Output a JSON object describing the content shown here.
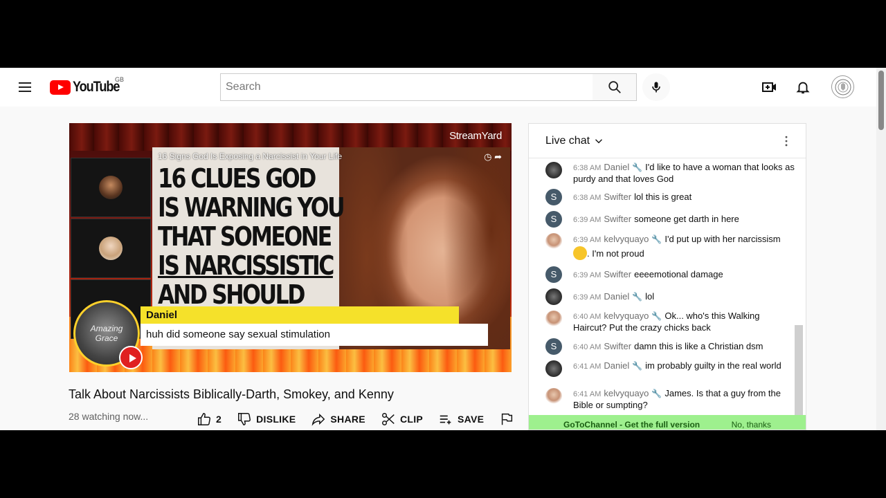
{
  "masthead": {
    "logo_text": "YouTube",
    "country_code": "GB",
    "search_placeholder": "Search"
  },
  "video": {
    "streamyard_label": "StreamYard",
    "thumbnail_caption": "16 Signs God Is Exposing a Narcissist in Your Life",
    "headline_lines": [
      "16 CLUES GOD",
      "IS WARNING YOU",
      "THAT SOMEONE",
      "IS NARCISSISTIC",
      "AND SHOULD"
    ],
    "badge_text": "Amazing Grace",
    "lower_third_name": "Daniel",
    "lower_third_message": "huh did someone say sexual stimulation",
    "title": "Talk About Narcissists Biblically-Darth, Smokey, and Kenny",
    "watching": "28 watching now...",
    "actions": {
      "like_count": "2",
      "dislike": "DISLIKE",
      "share": "SHARE",
      "clip": "CLIP",
      "save": "SAVE"
    }
  },
  "chat": {
    "title": "Live chat",
    "messages": [
      {
        "time": "6:38 AM",
        "author": "Daniel",
        "text": "I'd like to have a woman that looks as purdy and that loves God"
      },
      {
        "time": "6:38 AM",
        "author": "Swifter",
        "text": "lol this is great"
      },
      {
        "time": "6:39 AM",
        "author": "Swifter",
        "text": "someone get darth in here"
      },
      {
        "time": "6:39 AM",
        "author": "kelvyquayo",
        "text": "I'd put up with her narcissism",
        "text_after": ". I'm not proud"
      },
      {
        "time": "6:39 AM",
        "author": "Swifter",
        "text": "eeeemotional damage"
      },
      {
        "time": "6:39 AM",
        "author": "Daniel",
        "text": "lol"
      },
      {
        "time": "6:40 AM",
        "author": "kelvyquayo",
        "text": "Ok... who's this Walking Haircut? Put the crazy chicks back"
      },
      {
        "time": "6:40 AM",
        "author": "Swifter",
        "text": "damn this is like a Christian dsm"
      },
      {
        "time": "6:41 AM",
        "author": "Daniel",
        "text": "im probably guilty in the real world"
      },
      {
        "time": "6:41 AM",
        "author": "kelvyquayo",
        "text": "James. Is that a guy from the Bible or sumpting?"
      }
    ],
    "promo_text": "GoToChannel - Get the full version",
    "promo_dismiss": "No, thanks"
  }
}
